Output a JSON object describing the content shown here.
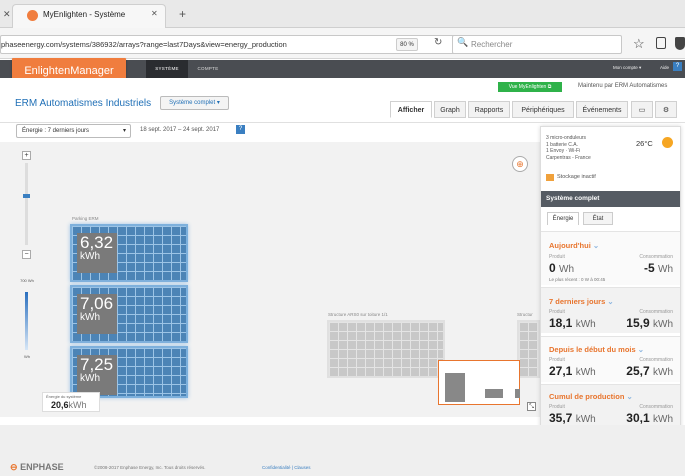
{
  "browser": {
    "tab_title": "MyEnlighten - Système",
    "url": "phaseenergy.com/systems/386932/arrays?range=last7Days&view=energy_production",
    "zoom": "80 %",
    "search_placeholder": "Rechercher"
  },
  "header": {
    "logo": "EnlightenManager",
    "nav": [
      "SYSTÈME",
      "COMPTE"
    ],
    "my_account": "Mon compte",
    "help": "Aide",
    "vue_button": "Vue MyEnlighten",
    "maintainer": "Maintenu par ERM Automatismes"
  },
  "system": {
    "name": "ERM Automatismes Industriels",
    "view_select": "Système complet",
    "tabs": [
      "Afficher",
      "Graph",
      "Rapports",
      "Périphériques",
      "Événements"
    ]
  },
  "filter": {
    "metric": "Énergie : 7 derniers jours",
    "date_range": "18 sept. 2017 – 24 sept. 2017",
    "help_icon": "?"
  },
  "canvas": {
    "array_label": "Parking ERM",
    "scale_top": "700 Wh",
    "scale_bottom": "Wh",
    "panels": [
      {
        "value": "6,32",
        "unit": "kWh"
      },
      {
        "value": "7,06",
        "unit": "kWh"
      },
      {
        "value": "7,25",
        "unit": "kWh"
      }
    ],
    "grey_label_1": "Structure ARS0 sur toiture 1/1",
    "grey_label_2": "Structur",
    "total_label": "Énergie du système",
    "total_value": "20,6",
    "total_unit": "kWh"
  },
  "status": {
    "lines": [
      "3 micro-onduleurs",
      "1 batterie C.A.",
      "1 Envoy · Wi-Fi",
      "Carpentras - France"
    ],
    "temperature": "26°C",
    "storage": "Stockage inactif"
  },
  "panel": {
    "title": "Système complet",
    "tabs": [
      "Énergie",
      "État"
    ],
    "sections": [
      {
        "title": "Aujourd'hui",
        "prod_label": "Produit",
        "prod_value": "0",
        "prod_unit": "Wh",
        "cons_label": "Consommation",
        "cons_value": "-5",
        "cons_unit": "Wh",
        "note": "Le plus récent : 0 W à 00:45"
      },
      {
        "title": "7 derniers jours",
        "prod_label": "Produit",
        "prod_value": "18,1",
        "prod_unit": "kWh",
        "cons_label": "Consommation",
        "cons_value": "15,9",
        "cons_unit": "kWh"
      },
      {
        "title": "Depuis le début du mois",
        "prod_label": "Produit",
        "prod_value": "27,1",
        "prod_unit": "kWh",
        "cons_label": "Consommation",
        "cons_value": "25,7",
        "cons_unit": "kWh"
      },
      {
        "title": "Cumul de production",
        "prod_label": "Produit",
        "prod_value": "35,7",
        "prod_unit": "kWh",
        "cons_label": "Consommation",
        "cons_value": "30,1",
        "cons_unit": "kWh"
      }
    ]
  },
  "footer": {
    "brand": "ENPHASE",
    "copyright": "©2008-2017 Enphase Energy, Inc. Tous droits réservés.",
    "links": "Confidentialité | Clauses"
  },
  "colors": {
    "accent": "#f07d3e",
    "panel_blue": "#4c84b6",
    "green": "#2fb24a"
  }
}
